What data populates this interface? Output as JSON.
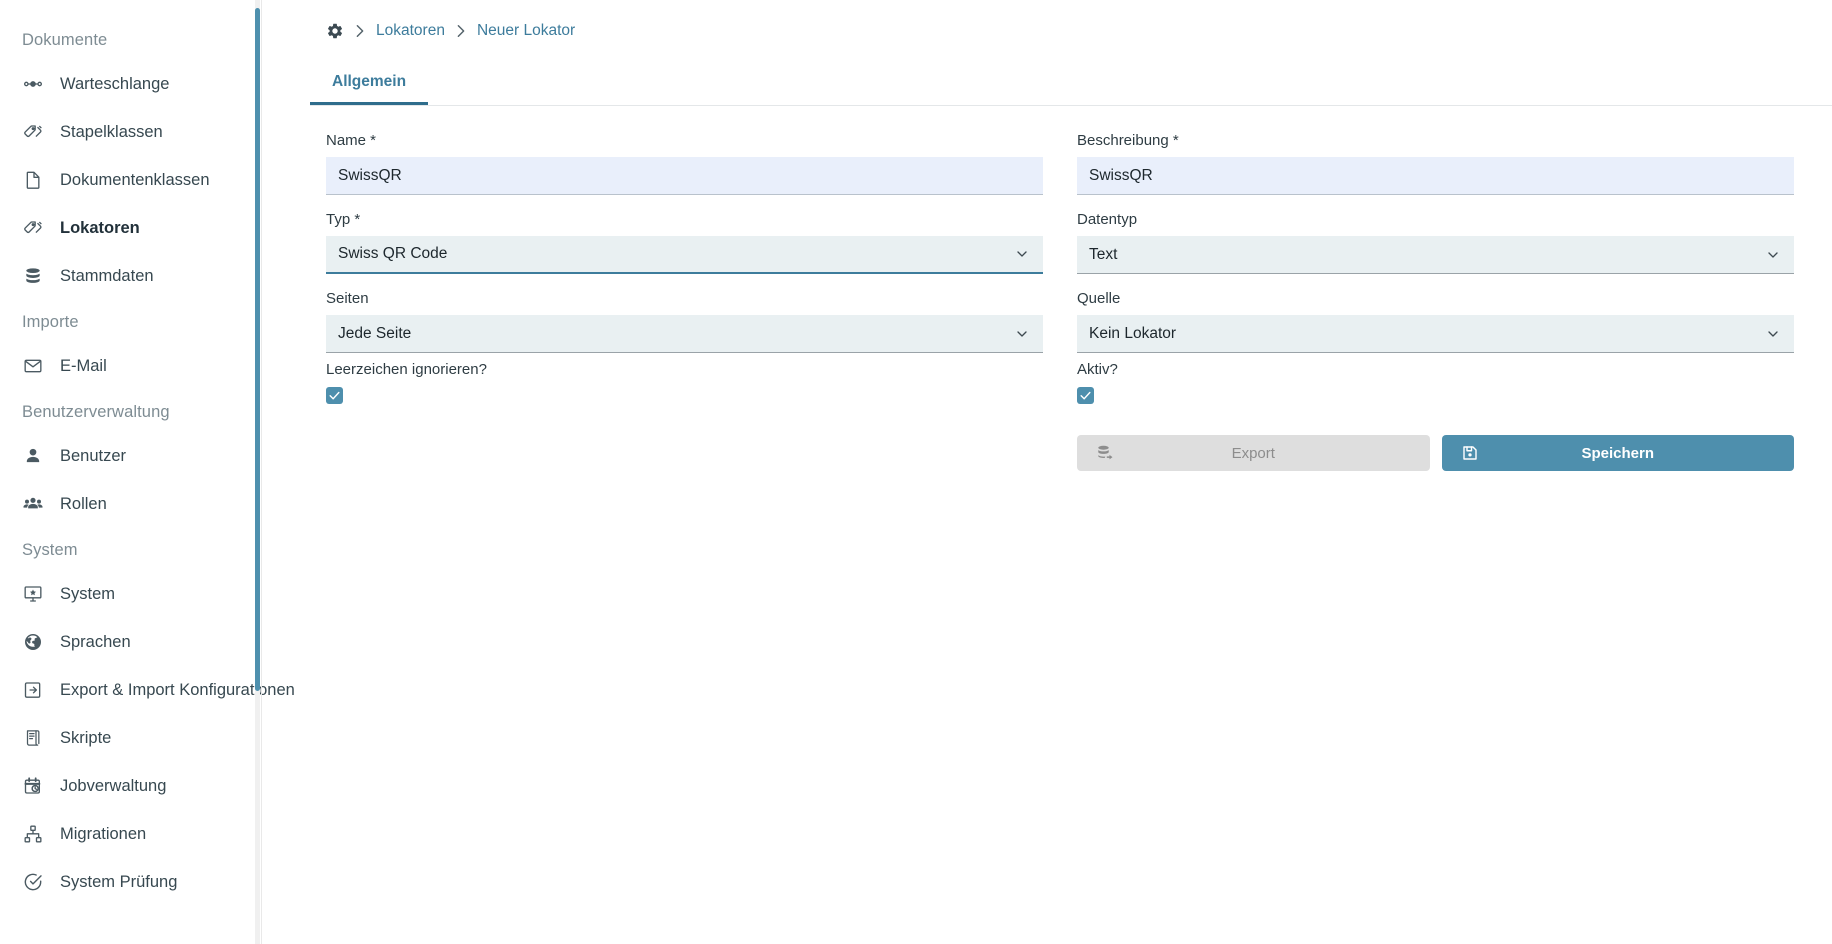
{
  "sidebar": {
    "groups": [
      {
        "label": "Dokumente",
        "items": [
          {
            "label": "Warteschlange",
            "icon": "queue-icon",
            "active": false
          },
          {
            "label": "Stapelklassen",
            "icon": "tags-icon",
            "active": false
          },
          {
            "label": "Dokumentenklassen",
            "icon": "document-icon",
            "active": false
          },
          {
            "label": "Lokatoren",
            "icon": "tags-icon",
            "active": true
          },
          {
            "label": "Stammdaten",
            "icon": "database-icon",
            "active": false
          }
        ]
      },
      {
        "label": "Importe",
        "items": [
          {
            "label": "E-Mail",
            "icon": "mail-icon",
            "active": false
          }
        ]
      },
      {
        "label": "Benutzerverwaltung",
        "items": [
          {
            "label": "Benutzer",
            "icon": "user-icon",
            "active": false
          },
          {
            "label": "Rollen",
            "icon": "users-icon",
            "active": false
          }
        ]
      },
      {
        "label": "System",
        "items": [
          {
            "label": "System",
            "icon": "monitor-icon",
            "active": false
          },
          {
            "label": "Sprachen",
            "icon": "globe-icon",
            "active": false
          },
          {
            "label": "Export & Import Konfigurationen",
            "icon": "import-export-icon",
            "active": false
          },
          {
            "label": "Skripte",
            "icon": "script-icon",
            "active": false
          },
          {
            "label": "Jobverwaltung",
            "icon": "calendar-clock-icon",
            "active": false
          },
          {
            "label": "Migrationen",
            "icon": "sitemap-icon",
            "active": false
          },
          {
            "label": "System Prüfung",
            "icon": "check-circle-icon",
            "active": false
          }
        ]
      }
    ]
  },
  "breadcrumb": {
    "home_icon": "gear-icon",
    "separator": "›",
    "items": [
      {
        "label": "Lokatoren"
      },
      {
        "label": "Neuer Lokator"
      }
    ]
  },
  "tabs": [
    {
      "label": "Allgemein",
      "active": true
    }
  ],
  "form": {
    "name": {
      "label": "Name *",
      "value": "SwissQR",
      "placeholder": ""
    },
    "beschreibung": {
      "label": "Beschreibung *",
      "value": "SwissQR",
      "placeholder": ""
    },
    "typ": {
      "label": "Typ *",
      "value": "Swiss QR Code",
      "focused": true
    },
    "datentyp": {
      "label": "Datentyp",
      "value": "Text",
      "focused": false
    },
    "seiten": {
      "label": "Seiten",
      "value": "Jede Seite",
      "focused": false
    },
    "quelle": {
      "label": "Quelle",
      "value": "Kein Lokator",
      "focused": false
    },
    "leerzeichen": {
      "label": "Leerzeichen ignorieren?",
      "checked": true
    },
    "aktiv": {
      "label": "Aktiv?",
      "checked": true
    }
  },
  "buttons": {
    "export": {
      "label": "Export",
      "icon": "database-export-icon",
      "disabled": true
    },
    "save": {
      "label": "Speichern",
      "icon": "save-icon",
      "disabled": false
    }
  },
  "colors": {
    "accent": "#4e8fad",
    "accent_dark": "#2f6d8c",
    "link": "#3d7c9c",
    "input_fill": "#e9effb",
    "select_fill": "#e9f0f2",
    "disabled_bg": "#dedede",
    "muted_text": "#7e8c93"
  }
}
